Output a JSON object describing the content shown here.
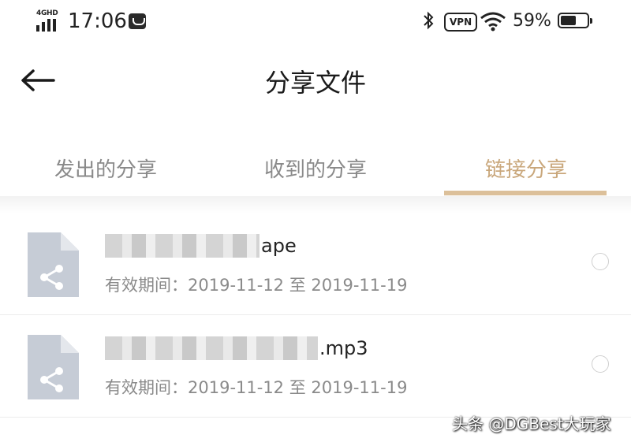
{
  "status_bar": {
    "network": "4GHD",
    "time": "17:06",
    "bluetooth_icon": "bluetooth-icon",
    "vpn": "VPN",
    "battery_percent": "59%",
    "battery_level": 0.59
  },
  "header": {
    "back_icon": "arrow-left-icon",
    "title": "分享文件"
  },
  "tabs": [
    {
      "label": "发出的分享",
      "active": false
    },
    {
      "label": "收到的分享",
      "active": false
    },
    {
      "label": "链接分享",
      "active": true
    }
  ],
  "accent_color": "#c9a77b",
  "files": [
    {
      "name_suffix": "ape",
      "validity": "有效期间：2019-11-12 至 2019-11-19",
      "selected": false
    },
    {
      "name_suffix": ".mp3",
      "validity": "有效期间：2019-11-12 至 2019-11-19",
      "selected": false
    }
  ],
  "watermark": "头条 @DGBest大玩家"
}
